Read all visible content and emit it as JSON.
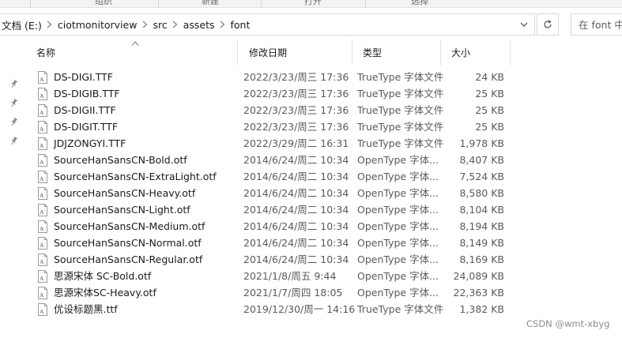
{
  "ribbon": {
    "groups": [
      "组织",
      "新建",
      "打开",
      "选择"
    ]
  },
  "address_bar": {
    "breadcrumbs": [
      "文档 (E:)",
      "ciotmonitorview",
      "src",
      "assets",
      "font"
    ]
  },
  "search": {
    "placeholder": "在 font 中搜索"
  },
  "columns": {
    "name": "名称",
    "date": "修改日期",
    "type": "类型",
    "size": "大小"
  },
  "files": [
    {
      "name": "DS-DIGI.TTF",
      "date": "2022/3/23/周三 17:36",
      "type": "TrueType 字体文件",
      "size": "24 KB"
    },
    {
      "name": "DS-DIGIB.TTF",
      "date": "2022/3/23/周三 17:36",
      "type": "TrueType 字体文件",
      "size": "25 KB"
    },
    {
      "name": "DS-DIGII.TTF",
      "date": "2022/3/23/周三 17:36",
      "type": "TrueType 字体文件",
      "size": "25 KB"
    },
    {
      "name": "DS-DIGIT.TTF",
      "date": "2022/3/23/周三 17:36",
      "type": "TrueType 字体文件",
      "size": "25 KB"
    },
    {
      "name": "JDJZONGYI.TTF",
      "date": "2022/3/29/周二 16:31",
      "type": "TrueType 字体文件",
      "size": "1,978 KB"
    },
    {
      "name": "SourceHanSansCN-Bold.otf",
      "date": "2014/6/24/周二 10:34",
      "type": "OpenType 字体...",
      "size": "8,407 KB"
    },
    {
      "name": "SourceHanSansCN-ExtraLight.otf",
      "date": "2014/6/24/周二 10:34",
      "type": "OpenType 字体...",
      "size": "7,524 KB"
    },
    {
      "name": "SourceHanSansCN-Heavy.otf",
      "date": "2014/6/24/周二 10:34",
      "type": "OpenType 字体...",
      "size": "8,580 KB"
    },
    {
      "name": "SourceHanSansCN-Light.otf",
      "date": "2014/6/24/周二 10:34",
      "type": "OpenType 字体...",
      "size": "8,104 KB"
    },
    {
      "name": "SourceHanSansCN-Medium.otf",
      "date": "2014/6/24/周二 10:34",
      "type": "OpenType 字体...",
      "size": "8,194 KB"
    },
    {
      "name": "SourceHanSansCN-Normal.otf",
      "date": "2014/6/24/周二 10:34",
      "type": "OpenType 字体...",
      "size": "8,149 KB"
    },
    {
      "name": "SourceHanSansCN-Regular.otf",
      "date": "2014/6/24/周二 10:34",
      "type": "OpenType 字体...",
      "size": "8,169 KB"
    },
    {
      "name": "思源宋体 SC-Bold.otf",
      "date": "2021/1/8/周五 9:44",
      "type": "OpenType 字体...",
      "size": "24,089 KB"
    },
    {
      "name": "思源宋体SC-Heavy.otf",
      "date": "2021/1/7/周四 18:05",
      "type": "OpenType 字体...",
      "size": "22,363 KB"
    },
    {
      "name": "优设标题黑.ttf",
      "date": "2019/12/30/周一 14:16",
      "type": "TrueType 字体文件",
      "size": "1,382 KB"
    }
  ],
  "watermark": "CSDN @wmt-xbyg",
  "colors": {
    "icon_accent": "#2b579a",
    "text_secondary": "#5a5a5a"
  }
}
